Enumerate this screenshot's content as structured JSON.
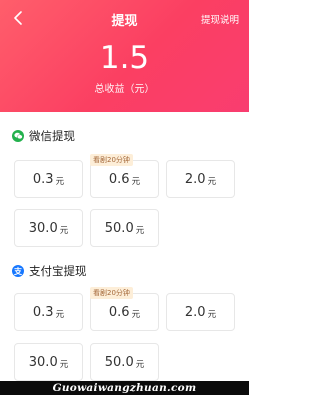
{
  "header": {
    "title": "提现",
    "help_link": "提现说明",
    "amount": "1.5",
    "amount_label": "总收益（元）"
  },
  "wechat": {
    "title": "微信提现",
    "options": [
      {
        "amount": "0.3",
        "unit": "元",
        "tag": ""
      },
      {
        "amount": "0.6",
        "unit": "元",
        "tag": "看剧20分钟"
      },
      {
        "amount": "2.0",
        "unit": "元",
        "tag": ""
      },
      {
        "amount": "30.0",
        "unit": "元",
        "tag": ""
      },
      {
        "amount": "50.0",
        "unit": "元",
        "tag": ""
      }
    ]
  },
  "alipay": {
    "title": "支付宝提现",
    "icon_letter": "支",
    "options": [
      {
        "amount": "0.3",
        "unit": "元",
        "tag": ""
      },
      {
        "amount": "0.6",
        "unit": "元",
        "tag": "看剧20分钟"
      },
      {
        "amount": "2.0",
        "unit": "元",
        "tag": ""
      },
      {
        "amount": "30.0",
        "unit": "元",
        "tag": ""
      },
      {
        "amount": "50.0",
        "unit": "元",
        "tag": ""
      }
    ]
  },
  "watermark": "Guowaiwangzhuan.com",
  "colors": {
    "header_start": "#ff5e6b",
    "header_end": "#f93d70",
    "wechat_green": "#23b14d",
    "alipay_blue": "#1677ff",
    "tag_bg": "#fdeed8",
    "tag_text": "#a4683a"
  }
}
